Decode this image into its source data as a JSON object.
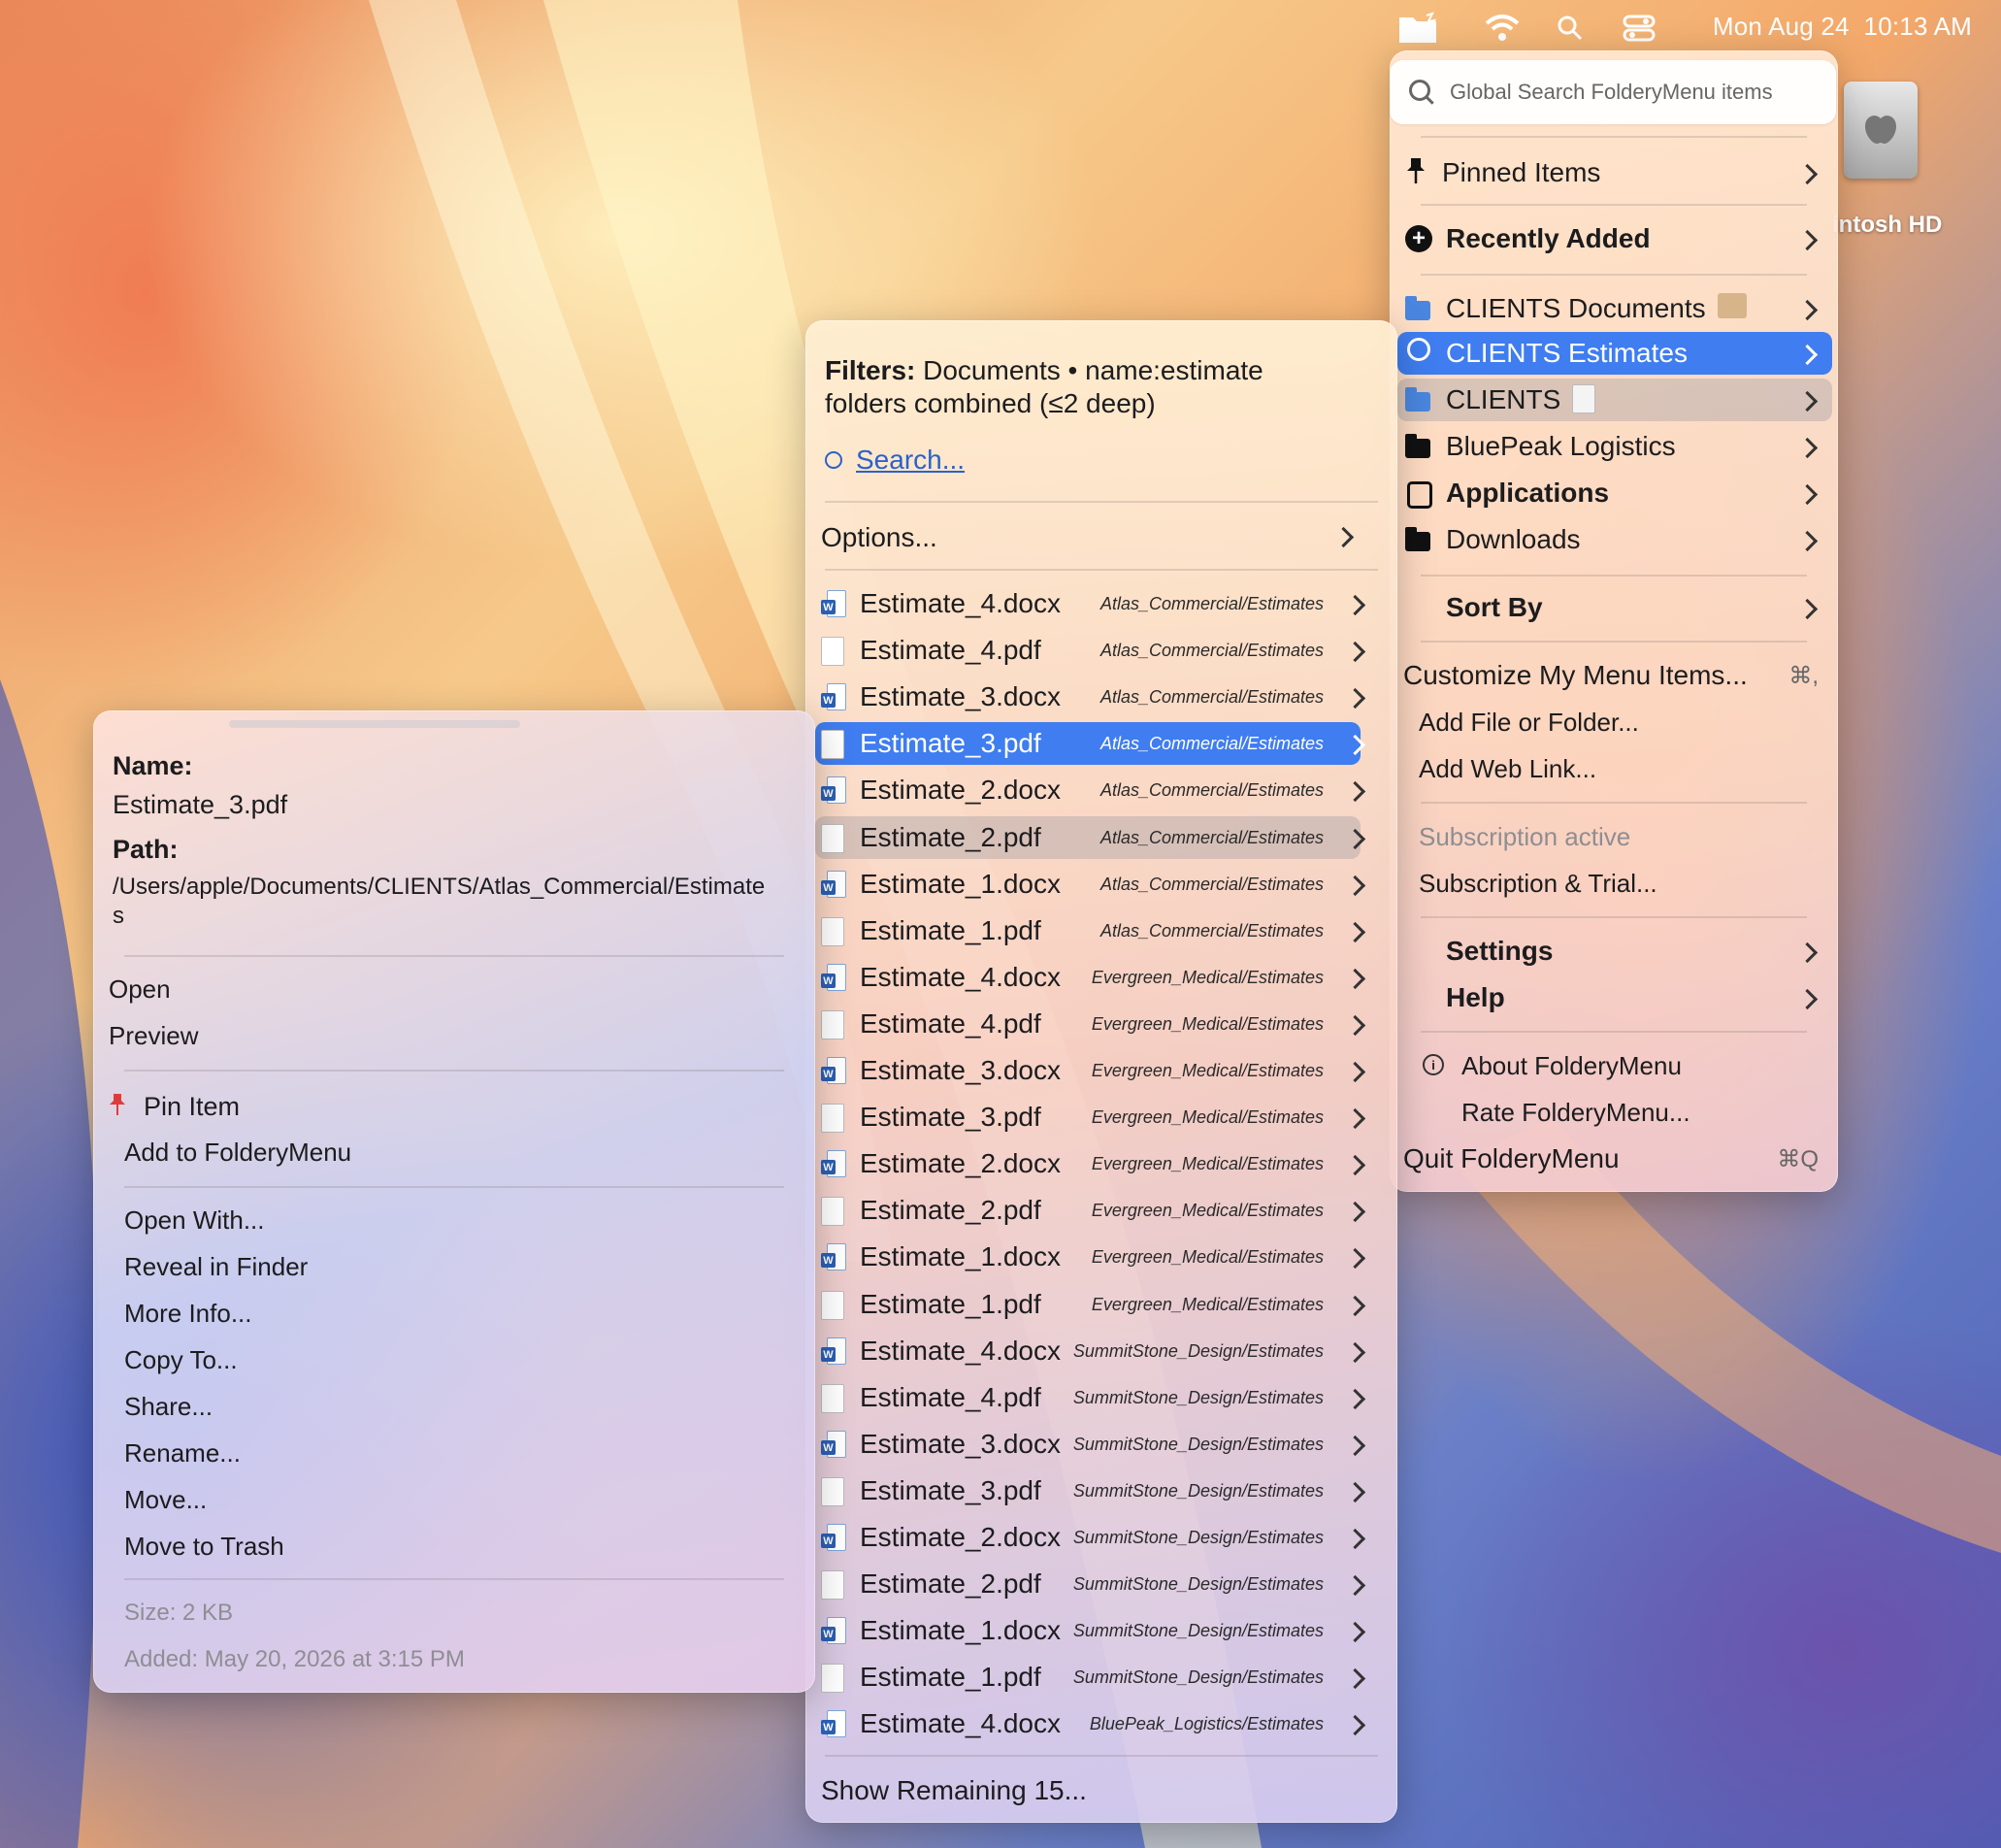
{
  "menubar": {
    "date": "Mon Aug 24",
    "time": "10:13 AM"
  },
  "desktop": {
    "drive_label": "intosh HD"
  },
  "main_menu": {
    "search_placeholder": "Global Search FolderyMenu items",
    "items": [
      {
        "label": "Pinned Items"
      },
      {
        "label": "Recently Added"
      },
      {
        "label": "CLIENTS Documents"
      },
      {
        "label": "CLIENTS Estimates"
      },
      {
        "label": "CLIENTS"
      },
      {
        "label": "BluePeak Logistics"
      },
      {
        "label": "Applications"
      },
      {
        "label": "Downloads"
      },
      {
        "label": "Sort By"
      },
      {
        "label": "Customize My Menu Items...",
        "shortcut": "⌘,"
      },
      {
        "label": "Add File or Folder..."
      },
      {
        "label": "Add Web Link..."
      },
      {
        "label": "Subscription active"
      },
      {
        "label": "Subscription & Trial..."
      },
      {
        "label": "Settings"
      },
      {
        "label": "Help"
      },
      {
        "label": "About FolderyMenu"
      },
      {
        "label": "Rate FolderyMenu..."
      },
      {
        "label": "Quit FolderyMenu",
        "shortcut": "⌘Q"
      }
    ]
  },
  "list_menu": {
    "filters_label": "Filters:",
    "filters_value": "Documents • name:estimate",
    "filters_line2": "folders combined (≤2 deep)",
    "search_link": "Search...",
    "options_label": "Options...",
    "files": [
      {
        "name": "Estimate_4.docx",
        "path": "Atlas_Commercial/Estimates",
        "type": "docx"
      },
      {
        "name": "Estimate_4.pdf",
        "path": "Atlas_Commercial/Estimates",
        "type": "pdf"
      },
      {
        "name": "Estimate_3.docx",
        "path": "Atlas_Commercial/Estimates",
        "type": "docx"
      },
      {
        "name": "Estimate_3.pdf",
        "path": "Atlas_Commercial/Estimates",
        "type": "pdf"
      },
      {
        "name": "Estimate_2.docx",
        "path": "Atlas_Commercial/Estimates",
        "type": "docx"
      },
      {
        "name": "Estimate_2.pdf",
        "path": "Atlas_Commercial/Estimates",
        "type": "pdf"
      },
      {
        "name": "Estimate_1.docx",
        "path": "Atlas_Commercial/Estimates",
        "type": "docx"
      },
      {
        "name": "Estimate_1.pdf",
        "path": "Atlas_Commercial/Estimates",
        "type": "pdf"
      },
      {
        "name": "Estimate_4.docx",
        "path": "Evergreen_Medical/Estimates",
        "type": "docx"
      },
      {
        "name": "Estimate_4.pdf",
        "path": "Evergreen_Medical/Estimates",
        "type": "pdf"
      },
      {
        "name": "Estimate_3.docx",
        "path": "Evergreen_Medical/Estimates",
        "type": "docx"
      },
      {
        "name": "Estimate_3.pdf",
        "path": "Evergreen_Medical/Estimates",
        "type": "pdf"
      },
      {
        "name": "Estimate_2.docx",
        "path": "Evergreen_Medical/Estimates",
        "type": "docx"
      },
      {
        "name": "Estimate_2.pdf",
        "path": "Evergreen_Medical/Estimates",
        "type": "pdf"
      },
      {
        "name": "Estimate_1.docx",
        "path": "Evergreen_Medical/Estimates",
        "type": "docx"
      },
      {
        "name": "Estimate_1.pdf",
        "path": "Evergreen_Medical/Estimates",
        "type": "pdf"
      },
      {
        "name": "Estimate_4.docx",
        "path": "SummitStone_Design/Estimates",
        "type": "docx"
      },
      {
        "name": "Estimate_4.pdf",
        "path": "SummitStone_Design/Estimates",
        "type": "pdf"
      },
      {
        "name": "Estimate_3.docx",
        "path": "SummitStone_Design/Estimates",
        "type": "docx"
      },
      {
        "name": "Estimate_3.pdf",
        "path": "SummitStone_Design/Estimates",
        "type": "pdf"
      },
      {
        "name": "Estimate_2.docx",
        "path": "SummitStone_Design/Estimates",
        "type": "docx"
      },
      {
        "name": "Estimate_2.pdf",
        "path": "SummitStone_Design/Estimates",
        "type": "pdf"
      },
      {
        "name": "Estimate_1.docx",
        "path": "SummitStone_Design/Estimates",
        "type": "docx"
      },
      {
        "name": "Estimate_1.pdf",
        "path": "SummitStone_Design/Estimates",
        "type": "pdf"
      },
      {
        "name": "Estimate_4.docx",
        "path": "BluePeak_Logistics/Estimates",
        "type": "docx"
      }
    ],
    "show_remaining": "Show Remaining 15..."
  },
  "context_menu": {
    "name_label": "Name:",
    "name_value": "Estimate_3.pdf",
    "path_label": "Path:",
    "path_value": "/Users/apple/Documents/CLIENTS/Atlas_Commercial/Estimate",
    "path_value_wrap": "s",
    "items_a": [
      "Open",
      "Preview"
    ],
    "pin_label": "Pin Item",
    "add_label": "Add to FolderyMenu",
    "items_b": [
      "Open With...",
      "Reveal in Finder",
      "More Info...",
      "Copy To...",
      "Share...",
      "Rename...",
      "Move...",
      "Move to Trash"
    ],
    "size": "Size: 2 KB",
    "added": "Added: May 20, 2026 at 3:15 PM"
  },
  "colors": {
    "selection_blue": "#3f7df0",
    "hover_gray": "rgba(150,150,160,0.35)",
    "link_blue": "#2a62c9",
    "disabled_text": "#8e8e93"
  }
}
